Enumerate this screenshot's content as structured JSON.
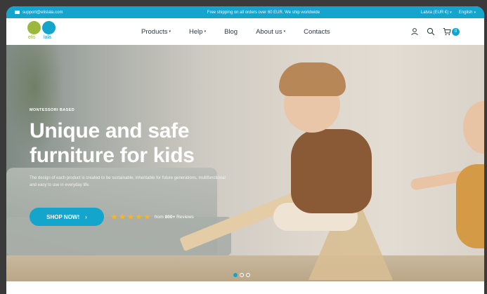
{
  "topbar": {
    "email": "support@elislala.com",
    "promo": "Free shipping on all orders over 60 EUR.  We ship worldwide",
    "currency": "Latvia (EUR €)",
    "language": "English"
  },
  "brand": {
    "logo_left": "elis",
    "logo_right": "lala"
  },
  "nav": {
    "products": "Products",
    "help": "Help",
    "blog": "Blog",
    "about": "About us",
    "contacts": "Contacts"
  },
  "cart": {
    "count": "0"
  },
  "hero": {
    "eyebrow": "MONTESSORI BASED",
    "headline_line1": "Unique and safe",
    "headline_line2": "furniture for kids",
    "subtext": "The design of each product is created to be sustainable, inheritable for future generations, multifunctional and easy to use in everyday life.",
    "cta": "SHOP NOW!",
    "cta_arrow": "›",
    "rating_stars": 5,
    "reviews_prefix": "from",
    "reviews_count": "800+",
    "reviews_suffix": "Reviews"
  },
  "carousel": {
    "slides": 3,
    "active": 0
  },
  "colors": {
    "accent": "#13a5cc",
    "green": "#9cb83a",
    "star": "#f5b42a"
  }
}
